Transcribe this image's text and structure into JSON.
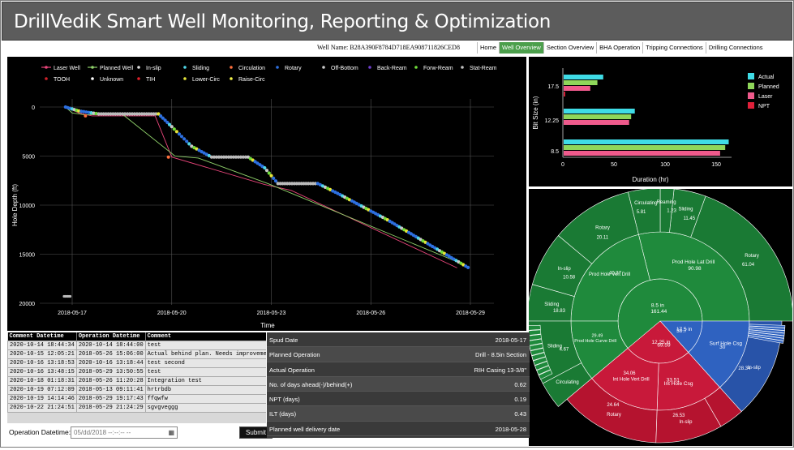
{
  "app": {
    "title": "DrillVediK Smart Well Monitoring, Reporting & Optimization",
    "well_label": "Well Name:",
    "well_name": "B28A390F8784D718EA908711826CED8"
  },
  "nav": {
    "links": [
      "Home",
      "Well Overview",
      "Section Overview",
      "BHA Operation",
      "Tripping Connections",
      "Drilling Connections"
    ],
    "active": "Well Overview"
  },
  "depth_chart": {
    "legend": [
      {
        "label": "Laser Well",
        "color": "#e8457a",
        "kind": "line"
      },
      {
        "label": "Planned Well",
        "color": "#8fd16a",
        "kind": "line"
      },
      {
        "label": "In-slip",
        "color": "#dddddd",
        "kind": "dot"
      },
      {
        "label": "Sliding",
        "color": "#4fd5e6",
        "kind": "dot"
      },
      {
        "label": "Circulation",
        "color": "#ff6f3c",
        "kind": "dot"
      },
      {
        "label": "Rotary",
        "color": "#2d6fe0",
        "kind": "dot"
      },
      {
        "label": "Off-Bottom",
        "color": "#c9c9c9",
        "kind": "dot"
      },
      {
        "label": "Back-Ream",
        "color": "#6f3fd0",
        "kind": "dot"
      },
      {
        "label": "Forw-Ream",
        "color": "#6fdc3a",
        "kind": "dot"
      },
      {
        "label": "Stat-Ream",
        "color": "#bfbfbf",
        "kind": "dot"
      },
      {
        "label": "TOOH",
        "color": "#d0222a",
        "kind": "dot"
      },
      {
        "label": "Unknown",
        "color": "#ffffff",
        "kind": "dot"
      },
      {
        "label": "TIH",
        "color": "#e0202a",
        "kind": "dot"
      },
      {
        "label": "Lower-Circ",
        "color": "#e5e53a",
        "kind": "dot"
      },
      {
        "label": "Raise-Circ",
        "color": "#f5f54a",
        "kind": "dot"
      }
    ],
    "ylabel": "Hole Depth (ft)",
    "xlabel": "Time",
    "yticks": [
      "0",
      "5000",
      "10000",
      "15000",
      "20000"
    ],
    "xticks": [
      "2018-05-17",
      "2018-05-20",
      "2018-05-23",
      "2018-05-26",
      "2018-05-29"
    ]
  },
  "chart_data": [
    {
      "type": "line",
      "x_unit": "days since 2018-05-17",
      "xlabel": "Time",
      "ylabel": "Hole Depth (ft)",
      "xlim": [
        "2018-05-16",
        "2018-05-29"
      ],
      "ylim": [
        20000,
        0
      ],
      "series": [
        {
          "name": "Laser Well",
          "x": [
            "2018-05-17",
            "2018-05-17",
            "2018-05-17",
            "2018-05-17",
            "2018-05-19",
            "2018-05-20",
            "2018-05-23",
            "2018-05-24",
            "2018-05-28"
          ],
          "y": [
            0,
            300,
            600,
            900,
            900,
            5100,
            7800,
            8500,
            16500
          ]
        },
        {
          "name": "Planned Well",
          "x": [
            "2018-05-17",
            "2018-05-17",
            "2018-05-17",
            "2018-05-18",
            "2018-05-20",
            "2018-05-21",
            "2018-05-23",
            "2018-05-28"
          ],
          "y": [
            0,
            600,
            800,
            700,
            5000,
            5200,
            7800,
            16000
          ]
        }
      ]
    },
    {
      "type": "bar",
      "orientation": "horizontal",
      "categories": [
        "17.5",
        "12.25",
        "8.5"
      ],
      "ylabel": "Bit Size (in)",
      "xlabel": "Duration (hr)",
      "xticks": [
        0,
        50,
        100,
        150
      ],
      "xlim": [
        0,
        165
      ],
      "series": [
        {
          "name": "Actual",
          "color": "#3fdce6",
          "values": [
            38.7,
            69.59,
            161.44
          ]
        },
        {
          "name": "Planned",
          "color": "#8fd65a",
          "values": [
            33.0,
            66.0,
            158.0
          ]
        },
        {
          "name": "Laser",
          "color": "#ef5a8c",
          "values": [
            26.0,
            64.0,
            153.0
          ]
        },
        {
          "name": "NPT",
          "color": "#e0203a",
          "values": [
            1.5,
            0.0,
            0.0
          ]
        }
      ]
    },
    {
      "type": "pie",
      "subtype": "sunburst",
      "rings": [
        {
          "level": "bit",
          "slices": [
            {
              "label": "8.5 in",
              "value": 161.44,
              "color": "#1f8a3c"
            },
            {
              "label": "12.25 in",
              "value": 69.59,
              "color": "#c8193a"
            },
            {
              "label": "17.5 in",
              "value": 38.7,
              "color": "#2f62c0"
            }
          ]
        },
        {
          "level": "section",
          "slices": [
            {
              "label": "Prod Hole Lat Drill",
              "value": 90.98,
              "color": "#1f8a3c"
            },
            {
              "label": "Prod Hole Vert Drill",
              "value": 40.37,
              "color": "#1f8a3c"
            },
            {
              "label": "Prod Hole Curve Drill",
              "value": 29.49,
              "color": "#1f8a3c"
            },
            {
              "label": "Int Hole Csg",
              "value": 33.51,
              "color": "#c8193a"
            },
            {
              "label": "Int Hole Vert Drill",
              "value": 34.06,
              "color": "#c8193a"
            },
            {
              "label": "Surf Hole Csg",
              "value": 30,
              "color": "#2f62c0"
            }
          ]
        },
        {
          "level": "operation",
          "slices": [
            {
              "label": "Rotary",
              "value": 61.04
            },
            {
              "label": "Sliding",
              "value": 11.45
            },
            {
              "label": "Reaming",
              "value": 1.23
            },
            {
              "label": "Circulating",
              "value": 5.81
            },
            {
              "label": "Rotary",
              "value": 20.11
            },
            {
              "label": "In-slip",
              "value": 10.58
            },
            {
              "label": "Circulating",
              "value": 0.0
            },
            {
              "label": "Sliding",
              "value": 18.83
            },
            {
              "label": "Sliding",
              "value": 4.67
            },
            {
              "label": "Circulating",
              "value": 0.0
            },
            {
              "label": "Rotary",
              "value": 24.64
            },
            {
              "label": "In-slip",
              "value": 26.53
            },
            {
              "label": "In-slip",
              "value": 28.34
            }
          ]
        }
      ]
    }
  ],
  "bar_chart": {
    "categories": [
      "17.5",
      "12.25",
      "8.5"
    ],
    "ylabel": "Bit Size (in)",
    "xlabel": "Duration (hr)",
    "xticks": [
      "0",
      "50",
      "100",
      "150"
    ],
    "legend": [
      "Actual",
      "Planned",
      "Laser",
      "NPT"
    ]
  },
  "sunburst": {
    "center_labels": [
      {
        "name": "8.5 in",
        "val": "161.44"
      },
      {
        "name": "12.25 in",
        "val": "69.59"
      },
      {
        "name": "17.5 in",
        "val": "38.7"
      }
    ],
    "mid_labels": [
      {
        "name": "Prod Hole Lat Drill",
        "val": "90.98"
      },
      {
        "name": "Prod Hole Vert Drill",
        "val": "40.37"
      },
      {
        "name": "Prod Hole Curve Drill",
        "val": "29.49"
      },
      {
        "name": "Int Hole Csg",
        "val": "33.51"
      },
      {
        "name": "Int Hole Vert Drill",
        "val": "34.06"
      },
      {
        "name": "Surf Hole Csg",
        "val": "30"
      }
    ],
    "outer_labels": [
      {
        "name": "Rotary",
        "val": "61.04"
      },
      {
        "name": "Sliding",
        "val": "11.45"
      },
      {
        "name": "Reaming",
        "val": "1.23"
      },
      {
        "name": "Circulating",
        "val": "5.81"
      },
      {
        "name": "Rotary",
        "val": "20.11"
      },
      {
        "name": "In-slip",
        "val": "10.58"
      },
      {
        "name": "Sliding",
        "val": "18.83"
      },
      {
        "name": "Sliding",
        "val": "4.67"
      },
      {
        "name": "Circulating",
        "val": ""
      },
      {
        "name": "Rotary",
        "val": "24.64"
      },
      {
        "name": "In-slip",
        "val": "26.53"
      },
      {
        "name": "In-slip",
        "val": "28.34"
      }
    ]
  },
  "comments": {
    "headers": [
      "Comment Datetime",
      "Operation Datetime",
      "Comment"
    ],
    "rows": [
      [
        "2020-10-14 18:44:34",
        "2020-10-14 18:44:00",
        "test"
      ],
      [
        "2020-10-15 12:05:21",
        "2018-05-26 15:06:00",
        "Actual behind plan. Needs improvement"
      ],
      [
        "2020-10-16 13:18:53",
        "2020-10-16 13:18:44",
        "test second"
      ],
      [
        "2020-10-16 13:48:15",
        "2018-05-29 13:50:55",
        "test"
      ],
      [
        "2020-10-18 01:18:31",
        "2018-05-26 11:20:28",
        "Integration test"
      ],
      [
        "2020-10-19 07:12:09",
        "2018-05-13 09:11:41",
        "hrtrbdb"
      ],
      [
        "2020-10-19 14:14:46",
        "2018-05-29 19:17:43",
        "ffqwfw"
      ],
      [
        "2020-10-22 21:24:51",
        "2018-05-29 21:24:29",
        "sgvgveggg"
      ]
    ]
  },
  "op_form": {
    "label": "Operation Datetime:",
    "placeholder": "05/dd/2018 --:--:-- --",
    "submit": "Submit"
  },
  "summary": [
    {
      "key": "Spud Date",
      "value": "2018-05-17"
    },
    {
      "key": "Planned Operation",
      "value": "Drill - 8.5in Section"
    },
    {
      "key": "Actual Operation",
      "value": "RIH Casing 13-3/8\""
    },
    {
      "key": "No. of days ahead(-)/behind(+)",
      "value": "0.62"
    },
    {
      "key": "NPT (days)",
      "value": "0.19"
    },
    {
      "key": "ILT (days)",
      "value": "0.43"
    },
    {
      "key": "Planned well delivery date",
      "value": "2018-05-28"
    }
  ]
}
